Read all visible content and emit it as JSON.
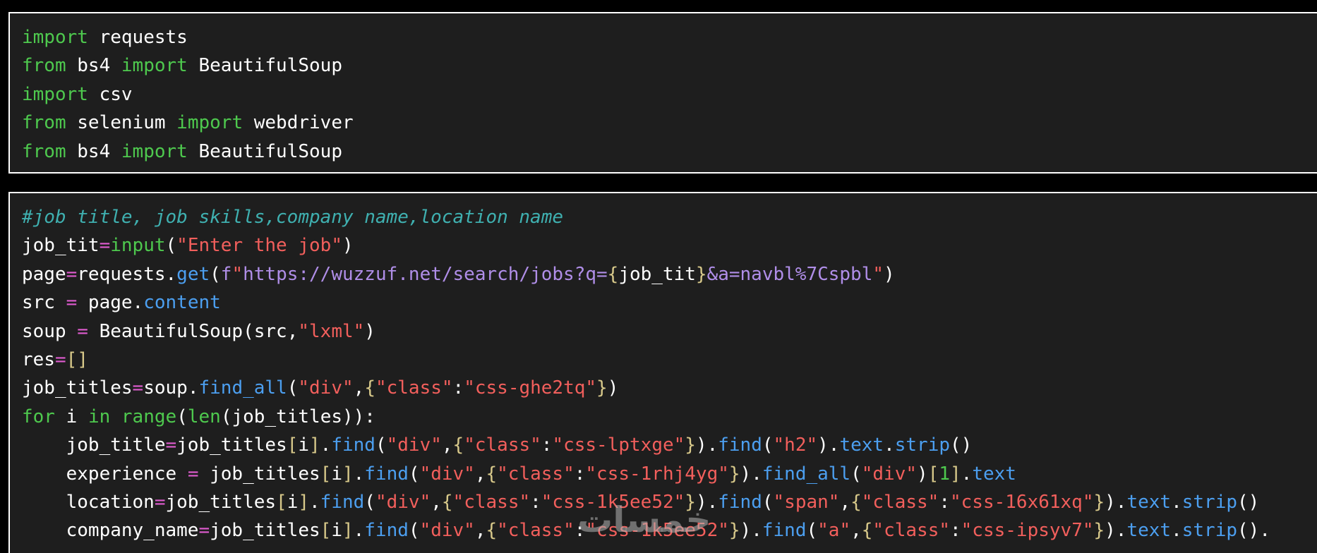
{
  "colors": {
    "background": "#000000",
    "panel": "#1e1e1e",
    "border": "#ffffff",
    "keyword": "#4ec94e",
    "default": "#ffffff",
    "operator": "#e05cd0",
    "string": "#f25f5c",
    "method": "#4c9ff0",
    "bracket": "#d8c98a",
    "comment": "#3fb0b0",
    "builtin": "#4ec94e",
    "number": "#4ec94e",
    "fstring_prefix": "#b08ee8"
  },
  "code_blocks": [
    {
      "id": "imports",
      "lines": [
        [
          [
            "keyword",
            "import"
          ],
          [
            "default",
            " requests"
          ]
        ],
        [
          [
            "keyword",
            "from"
          ],
          [
            "default",
            " bs4 "
          ],
          [
            "keyword",
            "import"
          ],
          [
            "default",
            " BeautifulSoup"
          ]
        ],
        [
          [
            "keyword",
            "import"
          ],
          [
            "default",
            " csv"
          ]
        ],
        [
          [
            "keyword",
            "from"
          ],
          [
            "default",
            " selenium "
          ],
          [
            "keyword",
            "import"
          ],
          [
            "default",
            " webdriver"
          ]
        ],
        [
          [
            "keyword",
            "from"
          ],
          [
            "default",
            " bs4 "
          ],
          [
            "keyword",
            "import"
          ],
          [
            "default",
            " BeautifulSoup"
          ]
        ]
      ]
    },
    {
      "id": "scraper",
      "lines": [
        [
          [
            "comment",
            "#job title, job skills,company name,location name"
          ]
        ],
        [
          [
            "default",
            "job_tit"
          ],
          [
            "operator",
            "="
          ],
          [
            "builtin",
            "input"
          ],
          [
            "default",
            "("
          ],
          [
            "string",
            "\"Enter the job\""
          ],
          [
            "default",
            ")"
          ]
        ],
        [
          [
            "default",
            "page"
          ],
          [
            "operator",
            "="
          ],
          [
            "default",
            "requests."
          ],
          [
            "method",
            "get"
          ],
          [
            "default",
            "("
          ],
          [
            "fstring_prefix",
            "f"
          ],
          [
            "string",
            "\""
          ],
          [
            "fstring_prefix",
            "https://wuzzuf.net/search/jobs?q="
          ],
          [
            "bracket",
            "{"
          ],
          [
            "default",
            "job_tit"
          ],
          [
            "bracket",
            "}"
          ],
          [
            "fstring_prefix",
            "&a=navbl%7Cspbl"
          ],
          [
            "string",
            "\""
          ],
          [
            "default",
            ")"
          ]
        ],
        [
          [
            "default",
            "src "
          ],
          [
            "operator",
            "="
          ],
          [
            "default",
            " page."
          ],
          [
            "method",
            "content"
          ]
        ],
        [
          [
            "default",
            "soup "
          ],
          [
            "operator",
            "="
          ],
          [
            "default",
            " BeautifulSoup(src,"
          ],
          [
            "string",
            "\"lxml\""
          ],
          [
            "default",
            ")"
          ]
        ],
        [
          [
            "default",
            "res"
          ],
          [
            "operator",
            "="
          ],
          [
            "bracket",
            "[]"
          ]
        ],
        [
          [
            "default",
            "job_titles"
          ],
          [
            "operator",
            "="
          ],
          [
            "default",
            "soup."
          ],
          [
            "method",
            "find_all"
          ],
          [
            "default",
            "("
          ],
          [
            "string",
            "\"div\""
          ],
          [
            "default",
            ","
          ],
          [
            "bracket",
            "{"
          ],
          [
            "string",
            "\"class\""
          ],
          [
            "default",
            ":"
          ],
          [
            "string",
            "\"css-ghe2tq\""
          ],
          [
            "bracket",
            "}"
          ],
          [
            "default",
            ")"
          ]
        ],
        [
          [
            "keyword",
            "for"
          ],
          [
            "default",
            " i "
          ],
          [
            "keyword",
            "in"
          ],
          [
            "default",
            " "
          ],
          [
            "builtin",
            "range"
          ],
          [
            "default",
            "("
          ],
          [
            "builtin",
            "len"
          ],
          [
            "default",
            "(job_titles)):"
          ]
        ],
        [
          [
            "default",
            "    job_title"
          ],
          [
            "operator",
            "="
          ],
          [
            "default",
            "job_titles"
          ],
          [
            "bracket",
            "["
          ],
          [
            "default",
            "i"
          ],
          [
            "bracket",
            "]"
          ],
          [
            "default",
            "."
          ],
          [
            "method",
            "find"
          ],
          [
            "default",
            "("
          ],
          [
            "string",
            "\"div\""
          ],
          [
            "default",
            ","
          ],
          [
            "bracket",
            "{"
          ],
          [
            "string",
            "\"class\""
          ],
          [
            "default",
            ":"
          ],
          [
            "string",
            "\"css-lptxge\""
          ],
          [
            "bracket",
            "}"
          ],
          [
            "default",
            ")."
          ],
          [
            "method",
            "find"
          ],
          [
            "default",
            "("
          ],
          [
            "string",
            "\"h2\""
          ],
          [
            "default",
            ")."
          ],
          [
            "method",
            "text"
          ],
          [
            "default",
            "."
          ],
          [
            "method",
            "strip"
          ],
          [
            "default",
            "()"
          ]
        ],
        [
          [
            "default",
            "    experience "
          ],
          [
            "operator",
            "="
          ],
          [
            "default",
            " job_titles"
          ],
          [
            "bracket",
            "["
          ],
          [
            "default",
            "i"
          ],
          [
            "bracket",
            "]"
          ],
          [
            "default",
            "."
          ],
          [
            "method",
            "find"
          ],
          [
            "default",
            "("
          ],
          [
            "string",
            "\"div\""
          ],
          [
            "default",
            ","
          ],
          [
            "bracket",
            "{"
          ],
          [
            "string",
            "\"class\""
          ],
          [
            "default",
            ":"
          ],
          [
            "string",
            "\"css-1rhj4yg\""
          ],
          [
            "bracket",
            "}"
          ],
          [
            "default",
            ")."
          ],
          [
            "method",
            "find_all"
          ],
          [
            "default",
            "("
          ],
          [
            "string",
            "\"div\""
          ],
          [
            "default",
            ")"
          ],
          [
            "bracket",
            "["
          ],
          [
            "number",
            "1"
          ],
          [
            "bracket",
            "]"
          ],
          [
            "default",
            "."
          ],
          [
            "method",
            "text"
          ]
        ],
        [
          [
            "default",
            "    location"
          ],
          [
            "operator",
            "="
          ],
          [
            "default",
            "job_titles"
          ],
          [
            "bracket",
            "["
          ],
          [
            "default",
            "i"
          ],
          [
            "bracket",
            "]"
          ],
          [
            "default",
            "."
          ],
          [
            "method",
            "find"
          ],
          [
            "default",
            "("
          ],
          [
            "string",
            "\"div\""
          ],
          [
            "default",
            ","
          ],
          [
            "bracket",
            "{"
          ],
          [
            "string",
            "\"class\""
          ],
          [
            "default",
            ":"
          ],
          [
            "string",
            "\"css-1k5ee52\""
          ],
          [
            "bracket",
            "}"
          ],
          [
            "default",
            ")."
          ],
          [
            "method",
            "find"
          ],
          [
            "default",
            "("
          ],
          [
            "string",
            "\"span\""
          ],
          [
            "default",
            ","
          ],
          [
            "bracket",
            "{"
          ],
          [
            "string",
            "\"class\""
          ],
          [
            "default",
            ":"
          ],
          [
            "string",
            "\"css-16x61xq\""
          ],
          [
            "bracket",
            "}"
          ],
          [
            "default",
            ")."
          ],
          [
            "method",
            "text"
          ],
          [
            "default",
            "."
          ],
          [
            "method",
            "strip"
          ],
          [
            "default",
            "()"
          ]
        ],
        [
          [
            "default",
            "    company_name"
          ],
          [
            "operator",
            "="
          ],
          [
            "default",
            "job_titles"
          ],
          [
            "bracket",
            "["
          ],
          [
            "default",
            "i"
          ],
          [
            "bracket",
            "]"
          ],
          [
            "default",
            "."
          ],
          [
            "method",
            "find"
          ],
          [
            "default",
            "("
          ],
          [
            "string",
            "\"div\""
          ],
          [
            "default",
            ","
          ],
          [
            "bracket",
            "{"
          ],
          [
            "string",
            "\"class\""
          ],
          [
            "default",
            ":"
          ],
          [
            "string",
            "\"css-1k5ee52\""
          ],
          [
            "bracket",
            "}"
          ],
          [
            "default",
            ")."
          ],
          [
            "method",
            "find"
          ],
          [
            "default",
            "("
          ],
          [
            "string",
            "\"a\""
          ],
          [
            "default",
            ","
          ],
          [
            "bracket",
            "{"
          ],
          [
            "string",
            "\"class\""
          ],
          [
            "default",
            ":"
          ],
          [
            "string",
            "\"css-ipsyv7\""
          ],
          [
            "bracket",
            "}"
          ],
          [
            "default",
            ")."
          ],
          [
            "method",
            "text"
          ],
          [
            "default",
            "."
          ],
          [
            "method",
            "strip"
          ],
          [
            "default",
            "()."
          ]
        ]
      ]
    }
  ],
  "watermark": {
    "text": "خمسات",
    "color": "rgba(180,180,180,0.55)"
  }
}
